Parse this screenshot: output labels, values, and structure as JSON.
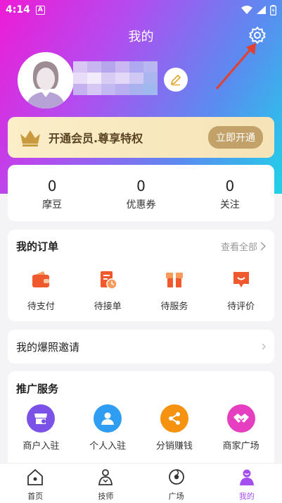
{
  "status_bar": {
    "time": "4:14",
    "notification_letter": "A"
  },
  "header": {
    "title": "我的"
  },
  "colors": {
    "gradient_start": "#ee1bd6",
    "gradient_end": "#1ed3e8",
    "vip_accent": "#c3a26a",
    "active_tab": "#a44ef0",
    "arrow": "#e2412f"
  },
  "vip": {
    "text": "开通会员.尊享特权",
    "button": "立即开通",
    "icon": "crown-icon"
  },
  "stats": [
    {
      "value": "0",
      "label": "摩豆"
    },
    {
      "value": "0",
      "label": "优惠券"
    },
    {
      "value": "0",
      "label": "关注"
    }
  ],
  "orders": {
    "title": "我的订单",
    "view_all": "查看全部",
    "items": [
      {
        "label": "待支付",
        "icon": "wallet-icon"
      },
      {
        "label": "待接单",
        "icon": "clock-document-icon"
      },
      {
        "label": "待服务",
        "icon": "gift-box-icon"
      },
      {
        "label": "待评价",
        "icon": "comment-icon"
      }
    ]
  },
  "invite": {
    "label": "我的爆照邀请"
  },
  "promo": {
    "title": "推广服务",
    "items": [
      {
        "label": "商户入驻",
        "icon": "merchant-icon",
        "color": "#7b52e8"
      },
      {
        "label": "个人入驻",
        "icon": "person-icon",
        "color": "#2f9df2"
      },
      {
        "label": "分销赚钱",
        "icon": "share-icon",
        "color": "#f5920f"
      },
      {
        "label": "商家广场",
        "icon": "handshake-icon",
        "color": "#e63ec0"
      }
    ]
  },
  "nav": [
    {
      "label": "首页",
      "icon": "home-icon"
    },
    {
      "label": "技师",
      "icon": "technician-icon"
    },
    {
      "label": "广场",
      "icon": "square-icon"
    },
    {
      "label": "我的",
      "icon": "profile-icon"
    }
  ]
}
